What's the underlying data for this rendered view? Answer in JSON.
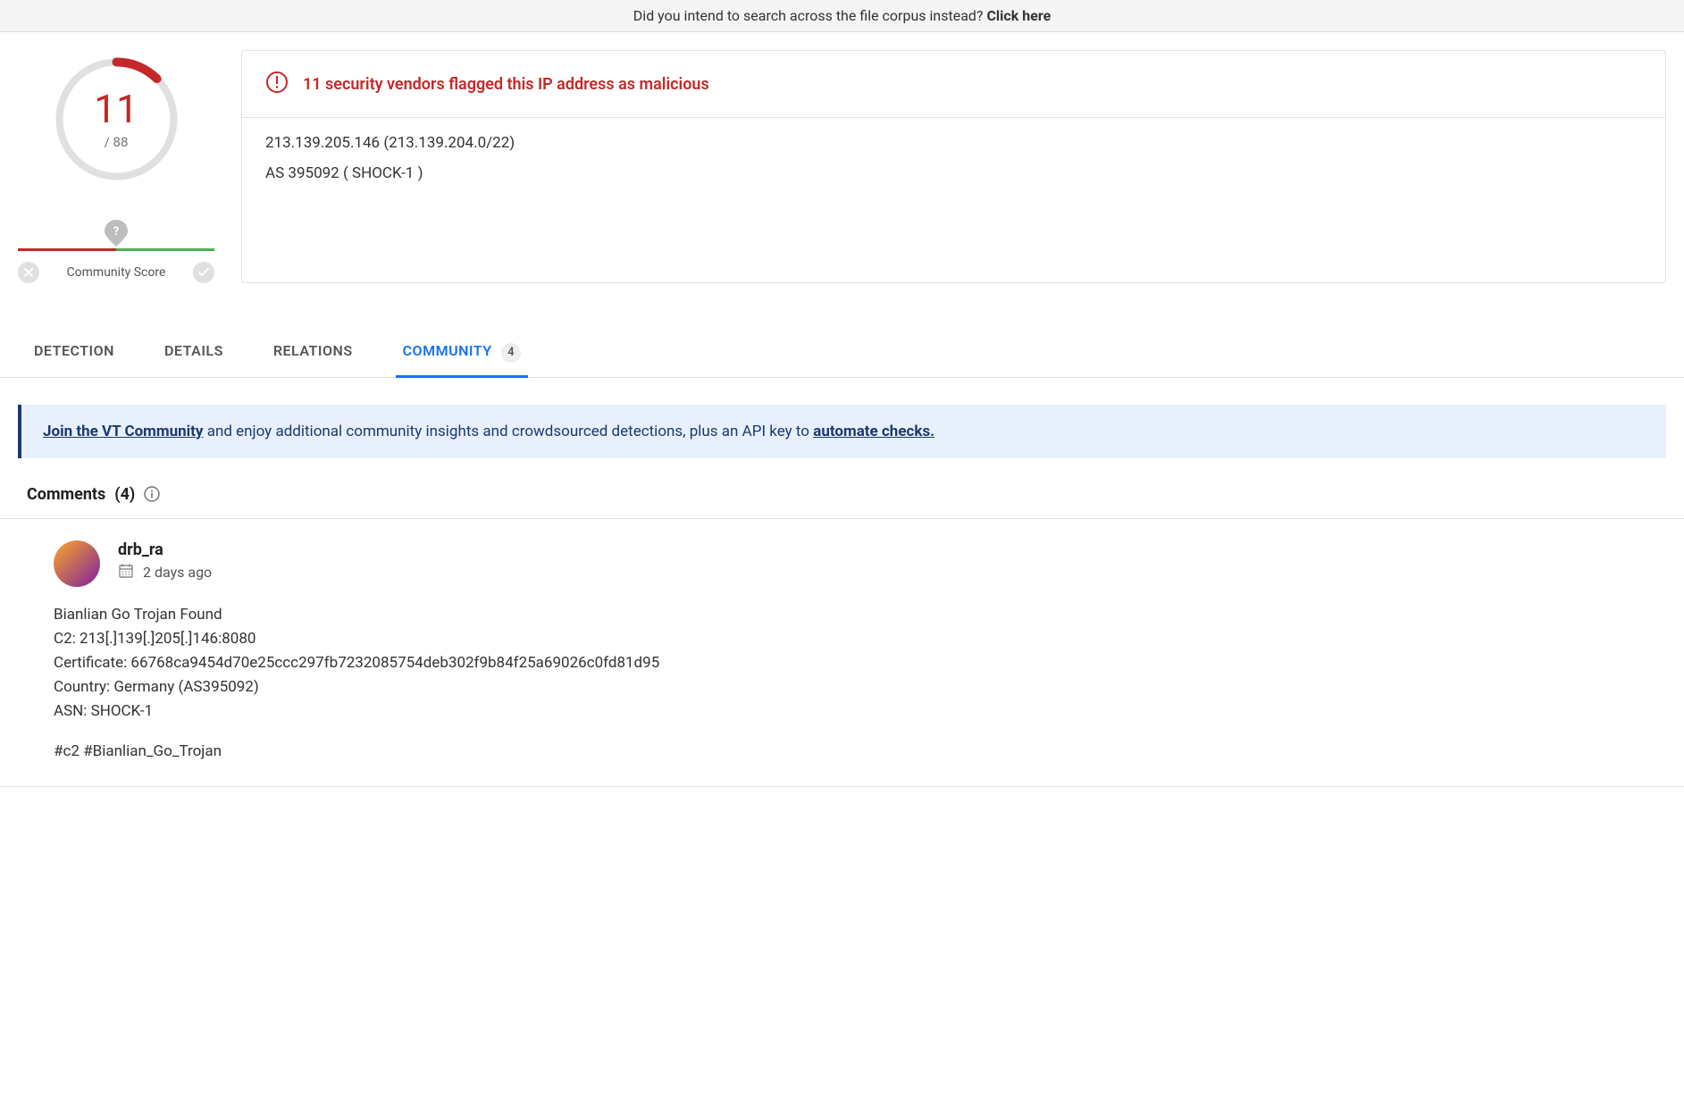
{
  "banner": {
    "text": "Did you intend to search across the file corpus instead? ",
    "link": "Click here"
  },
  "score": {
    "detections": "11",
    "total": "/ 88"
  },
  "community_score": {
    "label": "Community Score",
    "marker": "?"
  },
  "alert": {
    "text": "11 security vendors flagged this IP address as malicious"
  },
  "ip_info": {
    "line1": "213.139.205.146  (213.139.204.0/22)",
    "line2": "AS 395092  ( SHOCK-1 )"
  },
  "tabs": {
    "detection": "DETECTION",
    "details": "DETAILS",
    "relations": "RELATIONS",
    "community": "COMMUNITY",
    "community_count": "4"
  },
  "community_banner": {
    "join_link": "Join the VT Community",
    "middle": " and enjoy additional community insights and crowdsourced detections, plus an API key to ",
    "automate_link": "automate checks."
  },
  "comments": {
    "title": "Comments",
    "count": "(4)"
  },
  "comment1": {
    "author": "drb_ra",
    "time": "2 days ago",
    "line1": "Bianlian Go Trojan Found",
    "line2": "C2: 213[.]139[.]205[.]146:8080",
    "line3": "Certificate: 66768ca9454d70e25ccc297fb7232085754deb302f9b84f25a69026c0fd81d95",
    "line4": "Country: Germany (AS395092)",
    "line5": "ASN: SHOCK-1",
    "tags": "#c2 #Bianlian_Go_Trojan"
  }
}
